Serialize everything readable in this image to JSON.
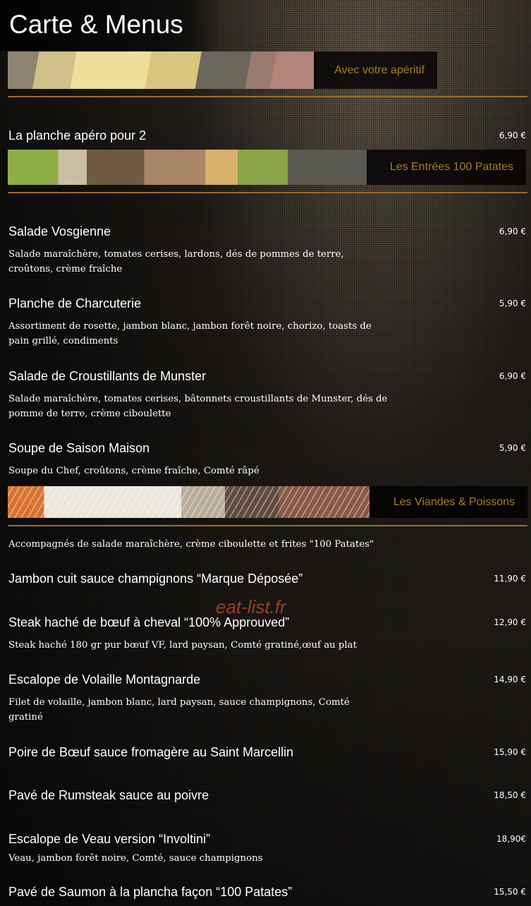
{
  "header": {
    "title": "Carte & Menus"
  },
  "banners": {
    "aperitif": "Avec votre apéritif",
    "entrees": "Les Entrées 100 Patates",
    "viandes": "Les Viandes & Poissons"
  },
  "aperitif": {
    "item": {
      "name": "La planche apéro pour 2",
      "price": "6,90 €"
    }
  },
  "entrees": {
    "items": [
      {
        "name": "Salade Vosgienne",
        "price": "6,90 €",
        "desc": "Salade maraîchère, tomates cerises, lardons, dés de pommes de terre, croûtons, crème fraîche"
      },
      {
        "name": "Planche de Charcuterie",
        "price": "5,90 €",
        "desc": "Assortiment de rosette, jambon blanc, jambon forêt noire, chorizo, toasts de pain grillé, condiments"
      },
      {
        "name": "Salade de Croustillants de Munster",
        "price": "6,90 €",
        "desc": "Salade maraîchère, tomates cerises, bâtonnets croustillants de Munster, dés de pomme de terre, crème ciboulette"
      },
      {
        "name": "Soupe de Saison Maison",
        "price": "5,90 €",
        "desc": "Soupe du Chef, croûtons, crème fraîche, Comté râpé"
      }
    ]
  },
  "viandes": {
    "intro": "Accompagnés de salade maraîchère, crème ciboulette et frites \"100 Patates\"",
    "items": [
      {
        "name": "Jambon cuit sauce champignons “Marque Déposée”",
        "price": "11,90 €"
      },
      {
        "name": "Steak haché de bœuf à cheval “100% Approuved”",
        "price": "12,90 €",
        "desc": "Steak haché 180 gr pur bœuf VF, lard paysan, Comté gratiné,œuf au plat"
      },
      {
        "name": "Escalope de Volaille Montagnarde",
        "price": "14,90 €",
        "desc": "Filet de volaille, jambon blanc, lard paysan, sauce champignons, Comté gratiné"
      },
      {
        "name": "Poire de Bœuf sauce fromagère au Saint Marcellin",
        "price": "15,90 €"
      },
      {
        "name": "Pavé de Rumsteak sauce au poivre",
        "price": "18,50 €"
      },
      {
        "name": "Escalope de Veau version “Involtini”",
        "price": "18,90€",
        "desc": "Veau, jambon forêt noire, Comté, sauce champignons"
      },
      {
        "name": "Pavé de Saumon à la plancha façon “100 Patates”",
        "price": "15,50 €"
      }
    ]
  },
  "watermark": "eat-list.fr"
}
